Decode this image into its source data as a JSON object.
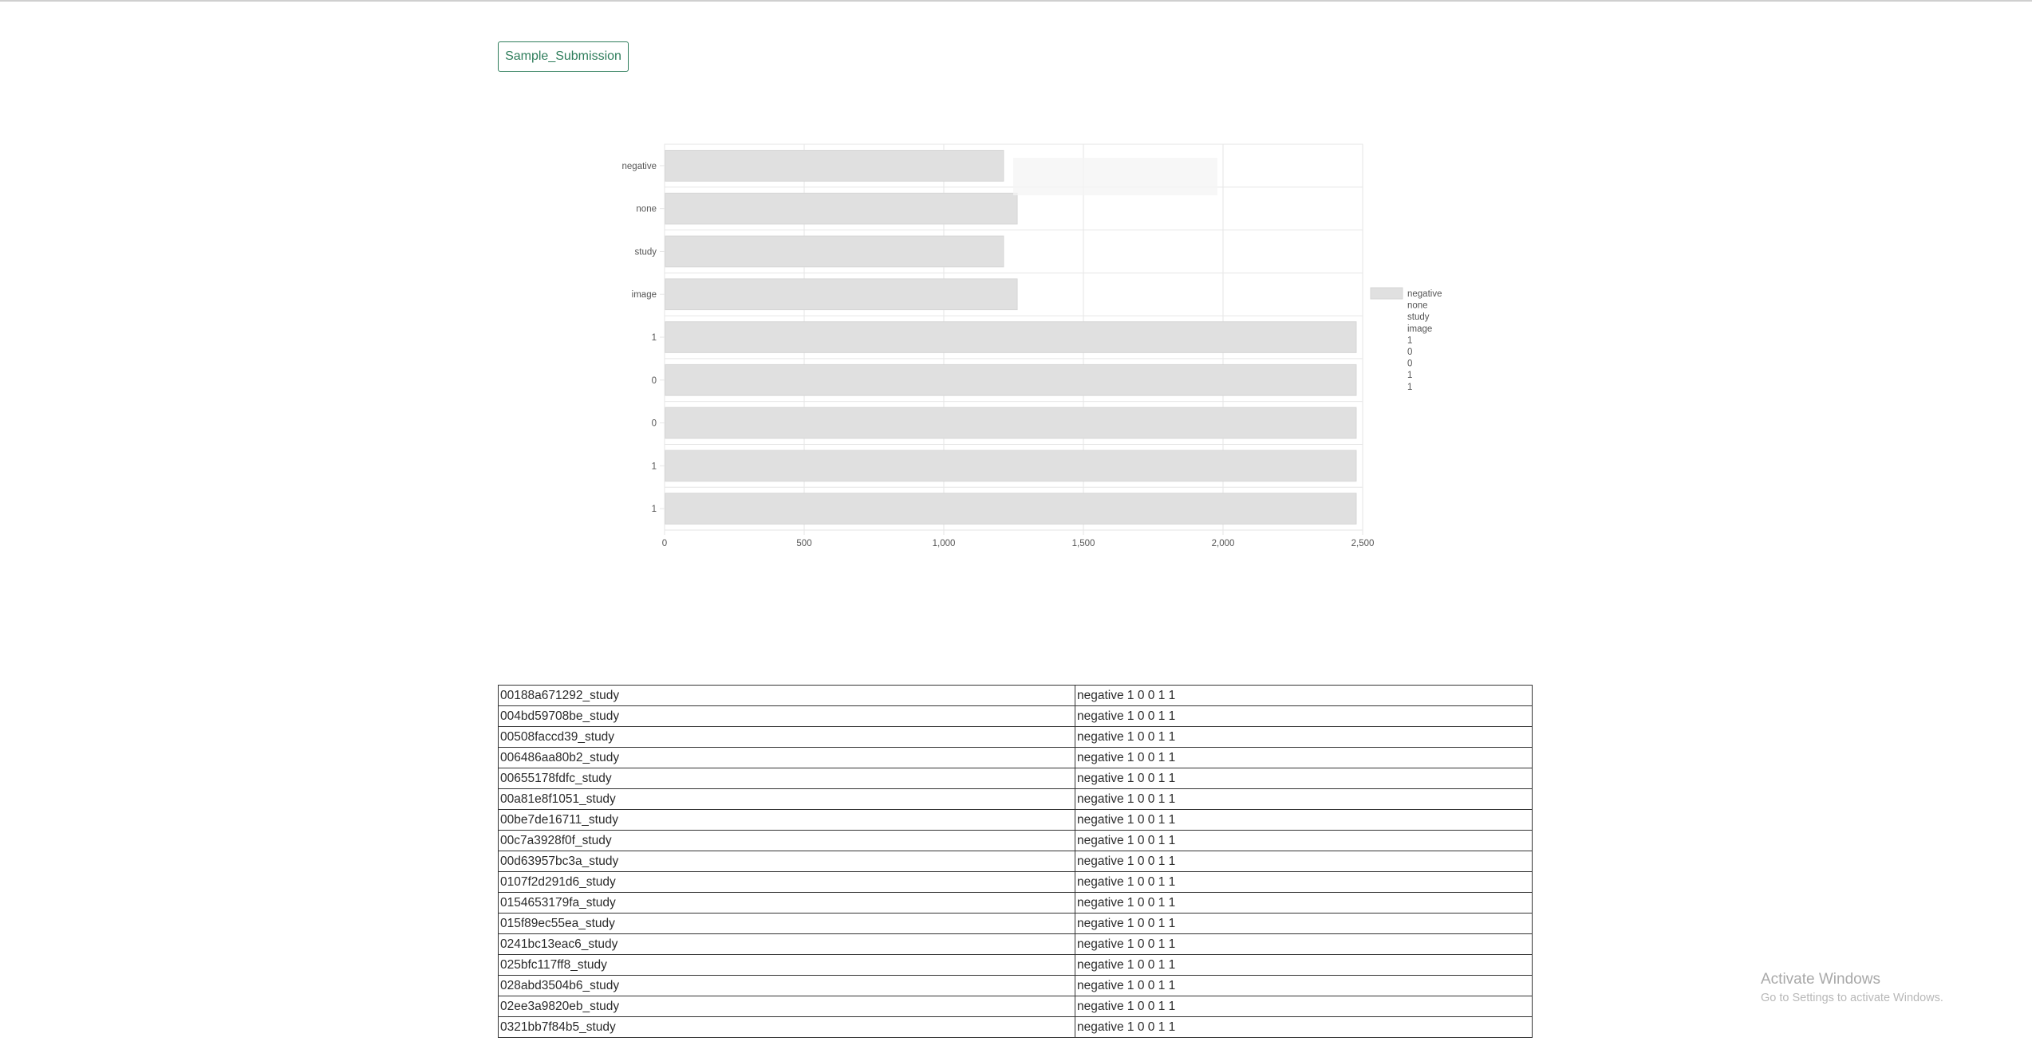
{
  "page": {
    "button_label": "Sample_Submission",
    "watermark_title": "Activate Windows",
    "watermark_subtitle": "Go to Settings to activate Windows."
  },
  "chart_data": {
    "type": "bar",
    "orientation": "horizontal",
    "categories": [
      "negative",
      "none",
      "study",
      "image",
      "1",
      "0",
      "0",
      "1",
      "1"
    ],
    "values": [
      1214,
      1263,
      1214,
      1263,
      2477,
      2477,
      2477,
      2477,
      2477
    ],
    "xlim": [
      0,
      2500
    ],
    "xticks": [
      "0",
      "500",
      "1,000",
      "1,500",
      "2,000",
      "2,500"
    ],
    "xtick_values": [
      0,
      500,
      1000,
      1500,
      2000,
      2500
    ],
    "grid": true,
    "legend": "right",
    "legend_entries": [
      "negative",
      "none",
      "study",
      "image",
      "1",
      "0",
      "0",
      "1",
      "1"
    ],
    "colors": {
      "bar": "#e0e0e0",
      "bar_stroke": "#d6d6d6",
      "grid": "#e6e6e6",
      "tick_text": "#555555"
    }
  },
  "table": {
    "rows": [
      [
        "00188a671292_study",
        "negative 1 0 0 1 1"
      ],
      [
        "004bd59708be_study",
        "negative 1 0 0 1 1"
      ],
      [
        "00508faccd39_study",
        "negative 1 0 0 1 1"
      ],
      [
        "006486aa80b2_study",
        "negative 1 0 0 1 1"
      ],
      [
        "00655178fdfc_study",
        "negative 1 0 0 1 1"
      ],
      [
        "00a81e8f1051_study",
        "negative 1 0 0 1 1"
      ],
      [
        "00be7de16711_study",
        "negative 1 0 0 1 1"
      ],
      [
        "00c7a3928f0f_study",
        "negative 1 0 0 1 1"
      ],
      [
        "00d63957bc3a_study",
        "negative 1 0 0 1 1"
      ],
      [
        "0107f2d291d6_study",
        "negative 1 0 0 1 1"
      ],
      [
        "0154653179fa_study",
        "negative 1 0 0 1 1"
      ],
      [
        "015f89ec55ea_study",
        "negative 1 0 0 1 1"
      ],
      [
        "0241bc13eac6_study",
        "negative 1 0 0 1 1"
      ],
      [
        "025bfc117ff8_study",
        "negative 1 0 0 1 1"
      ],
      [
        "028abd3504b6_study",
        "negative 1 0 0 1 1"
      ],
      [
        "02ee3a9820eb_study",
        "negative 1 0 0 1 1"
      ],
      [
        "0321bb7f84b5_study",
        "negative 1 0 0 1 1"
      ]
    ]
  }
}
